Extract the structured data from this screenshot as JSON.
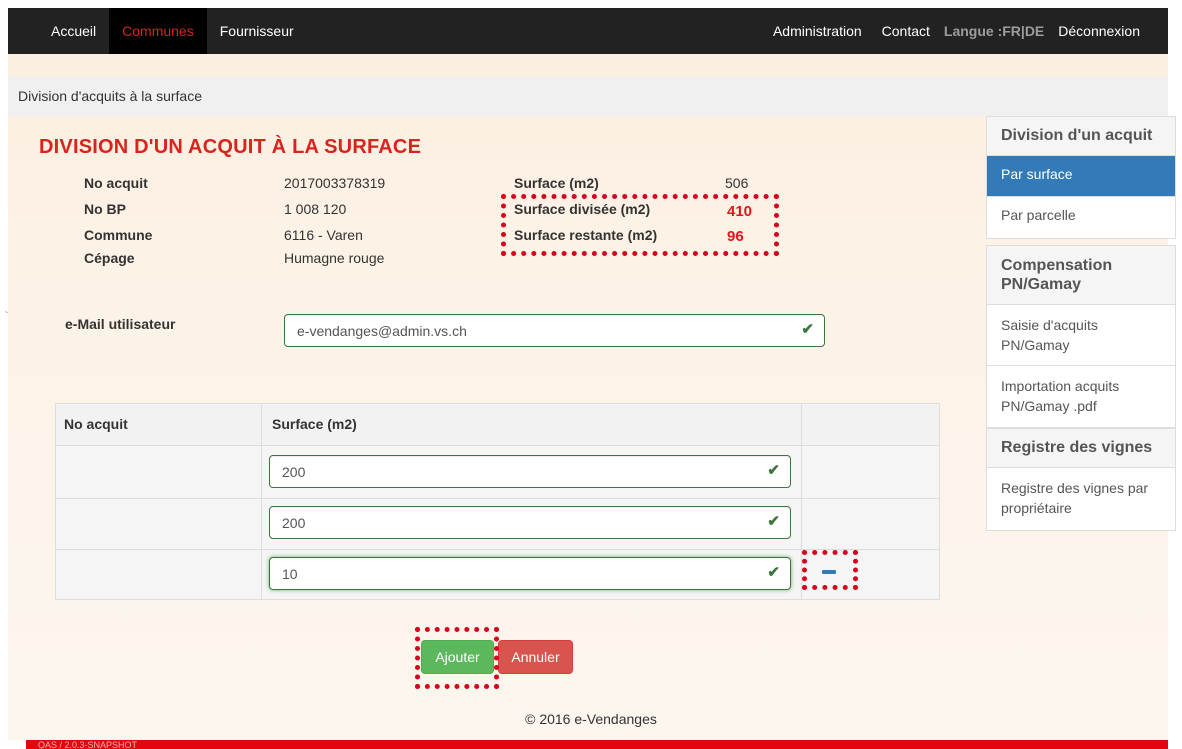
{
  "nav": {
    "left": [
      "Accueil",
      "Communes",
      "Fournisseur"
    ],
    "right": {
      "admin": "Administration",
      "contact": "Contact",
      "langue": "Langue :FR|DE",
      "logout": "Déconnexion"
    }
  },
  "breadcrumb": "Division d'acquits à la surface",
  "title": "DIVISION D'UN ACQUIT À LA SURFACE",
  "info": {
    "no_acquit_label": "No acquit",
    "no_acquit_value": "2017003378319",
    "no_bp_label": "No BP",
    "no_bp_value": "1 008 120",
    "commune_label": "Commune",
    "commune_value": "6116 - Varen",
    "cepage_label": "Cépage",
    "cepage_value": "Humagne rouge",
    "surface_label": "Surface (m2)",
    "surface_value": "506",
    "surface_divisee_label": "Surface divisée (m2)",
    "surface_divisee_value": "410",
    "surface_restante_label": "Surface restante (m2)",
    "surface_restante_value": "96"
  },
  "email": {
    "label": "e-Mail utilisateur",
    "value": "e-vendanges@admin.vs.ch"
  },
  "table": {
    "headers": [
      "No acquit",
      "Surface (m2)"
    ],
    "rows": [
      {
        "no_acquit": "",
        "surface": "200"
      },
      {
        "no_acquit": "",
        "surface": "200"
      },
      {
        "no_acquit": "",
        "surface": "10"
      }
    ]
  },
  "buttons": {
    "add": "Ajouter",
    "cancel": "Annuler"
  },
  "footer": "© 2016 e-Vendanges",
  "version": "QAS / 2.0.3-SNAPSHOT",
  "sidebar": {
    "division": {
      "title": "Division d'un acquit",
      "items": [
        "Par surface",
        "Par parcelle"
      ]
    },
    "compensation": {
      "title": "Compensation PN/Gamay",
      "items": [
        "Saisie d'acquits PN/Gamay",
        "Importation acquits PN/Gamay .pdf"
      ]
    },
    "registre": {
      "title": "Registre des vignes",
      "items": [
        "Registre des vignes par propriétaire"
      ]
    }
  },
  "colors": {
    "navbar": "#222222",
    "title_red": "#d9231d",
    "annotation_red": "#d9001c",
    "active_blue": "#337ab7",
    "success_green": "#5cb85c",
    "danger_red": "#d9534f"
  }
}
